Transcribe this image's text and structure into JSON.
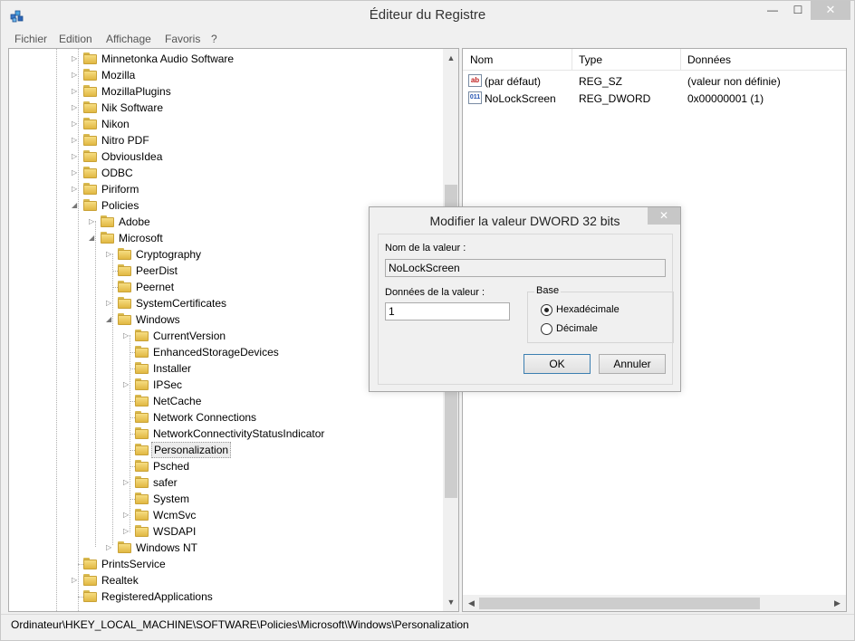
{
  "window": {
    "title": "Éditeur du Registre",
    "min_glyph": "—",
    "max_glyph": "☐",
    "close_glyph": "✕"
  },
  "menu": [
    "Fichier",
    "Edition",
    "Affichage",
    "Favoris",
    "?"
  ],
  "tree": [
    {
      "label": "Minnetonka Audio Software",
      "depth": 0,
      "expander": "collapsed"
    },
    {
      "label": "Mozilla",
      "depth": 0,
      "expander": "collapsed"
    },
    {
      "label": "MozillaPlugins",
      "depth": 0,
      "expander": "collapsed"
    },
    {
      "label": "Nik Software",
      "depth": 0,
      "expander": "collapsed"
    },
    {
      "label": "Nikon",
      "depth": 0,
      "expander": "collapsed"
    },
    {
      "label": "Nitro PDF",
      "depth": 0,
      "expander": "collapsed"
    },
    {
      "label": "ObviousIdea",
      "depth": 0,
      "expander": "collapsed"
    },
    {
      "label": "ODBC",
      "depth": 0,
      "expander": "collapsed"
    },
    {
      "label": "Piriform",
      "depth": 0,
      "expander": "collapsed"
    },
    {
      "label": "Policies",
      "depth": 0,
      "expander": "expanded"
    },
    {
      "label": "Adobe",
      "depth": 1,
      "expander": "collapsed"
    },
    {
      "label": "Microsoft",
      "depth": 1,
      "expander": "expanded"
    },
    {
      "label": "Cryptography",
      "depth": 2,
      "expander": "collapsed"
    },
    {
      "label": "PeerDist",
      "depth": 2,
      "expander": "none"
    },
    {
      "label": "Peernet",
      "depth": 2,
      "expander": "none"
    },
    {
      "label": "SystemCertificates",
      "depth": 2,
      "expander": "collapsed"
    },
    {
      "label": "Windows",
      "depth": 2,
      "expander": "expanded"
    },
    {
      "label": "CurrentVersion",
      "depth": 3,
      "expander": "collapsed"
    },
    {
      "label": "EnhancedStorageDevices",
      "depth": 3,
      "expander": "none"
    },
    {
      "label": "Installer",
      "depth": 3,
      "expander": "none"
    },
    {
      "label": "IPSec",
      "depth": 3,
      "expander": "collapsed"
    },
    {
      "label": "NetCache",
      "depth": 3,
      "expander": "none"
    },
    {
      "label": "Network Connections",
      "depth": 3,
      "expander": "none"
    },
    {
      "label": "NetworkConnectivityStatusIndicator",
      "depth": 3,
      "expander": "none"
    },
    {
      "label": "Personalization",
      "depth": 3,
      "expander": "none",
      "selected": true
    },
    {
      "label": "Psched",
      "depth": 3,
      "expander": "none"
    },
    {
      "label": "safer",
      "depth": 3,
      "expander": "collapsed"
    },
    {
      "label": "System",
      "depth": 3,
      "expander": "none"
    },
    {
      "label": "WcmSvc",
      "depth": 3,
      "expander": "collapsed"
    },
    {
      "label": "WSDAPI",
      "depth": 3,
      "expander": "collapsed"
    },
    {
      "label": "Windows NT",
      "depth": 2,
      "expander": "collapsed"
    },
    {
      "label": "PrintsService",
      "depth": 0,
      "expander": "none"
    },
    {
      "label": "Realtek",
      "depth": 0,
      "expander": "collapsed"
    },
    {
      "label": "RegisteredApplications",
      "depth": 0,
      "expander": "none"
    }
  ],
  "list": {
    "columns": [
      "Nom",
      "Type",
      "Données"
    ],
    "rows": [
      {
        "icon": "string-value-icon",
        "icon_text": "ab",
        "name": "(par défaut)",
        "type": "REG_SZ",
        "data": "(valeur non définie)"
      },
      {
        "icon": "binary-value-icon",
        "icon_text": "011",
        "name": "NoLockScreen",
        "type": "REG_DWORD",
        "data": "0x00000001 (1)"
      }
    ]
  },
  "status": {
    "path": "Ordinateur\\HKEY_LOCAL_MACHINE\\SOFTWARE\\Policies\\Microsoft\\Windows\\Personalization"
  },
  "dialog": {
    "title": "Modifier la valeur DWORD 32 bits",
    "close_glyph": "✕",
    "name_label": "Nom de la valeur :",
    "name_value": "NoLockScreen",
    "data_label": "Données de la valeur :",
    "data_value": "1",
    "base_label": "Base",
    "radio_hex": "Hexadécimale",
    "radio_dec": "Décimale",
    "selected_base": "hex",
    "ok_label": "OK",
    "cancel_label": "Annuler"
  },
  "scroll_glyphs": {
    "up": "▲",
    "down": "▼",
    "left": "◀",
    "right": "▶"
  }
}
